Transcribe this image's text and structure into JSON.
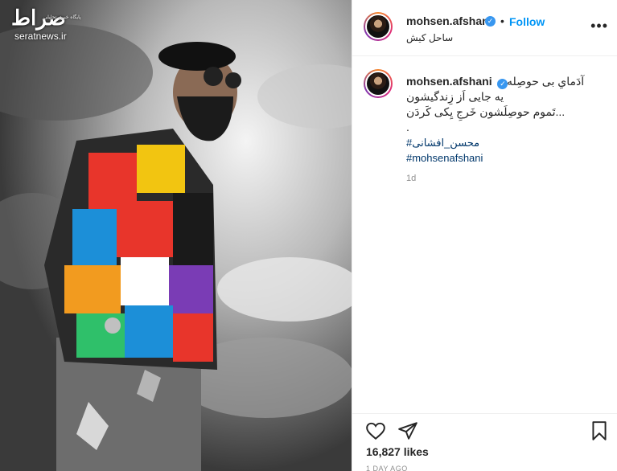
{
  "watermark": {
    "logo": "صراط",
    "tagline": "پایگاه خبری تحلیلی",
    "site": "seratnews.ir"
  },
  "post": {
    "username": "mohsen.afshani",
    "verified_icon": "verified-badge-icon",
    "separator": "•",
    "follow_label": "Follow",
    "location": "ساحل کیش",
    "more_icon": "more-options-icon",
    "caption": {
      "line1": "آدَمایِ بی حوصِله",
      "line2": "یه جایی اَز زِندگیشون",
      "line3": "...تَموم حوصِلَشون خَرجِ یِکی کَردَن",
      "line4": ".",
      "tag1": "#محسن_افشانی",
      "tag2": "#mohsenafshani"
    },
    "age": "1d",
    "likes": "16,827 likes",
    "time_ago": "1 DAY AGO"
  },
  "actions": {
    "like_icon": "heart-icon",
    "share_icon": "share-icon",
    "save_icon": "bookmark-icon"
  },
  "colors": {
    "follow": "#0095f6",
    "verified": "#3897f0",
    "hashtag": "#00376b",
    "muted": "#8e8e8e"
  }
}
